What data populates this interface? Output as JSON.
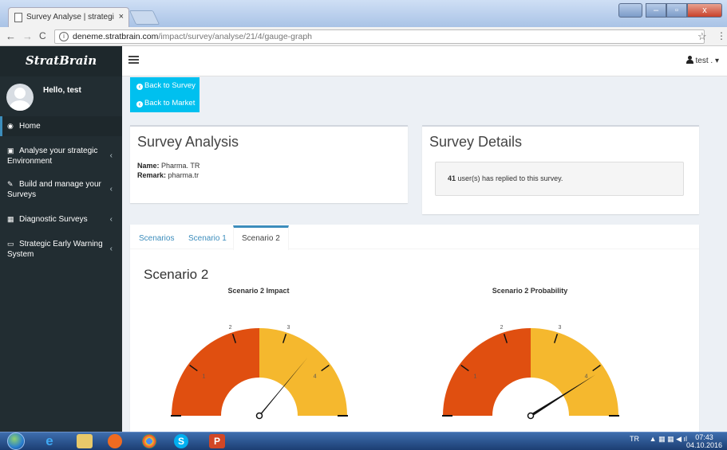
{
  "browser": {
    "tab_title": "Survey Analyse | strategi",
    "tab_close": "×",
    "url_host": "deneme.stratbrain.com",
    "url_path": "/impact/survey/analyse/21/4/gauge-graph",
    "back": "←",
    "forward": "→",
    "reload": "C",
    "info": "i",
    "bookmark": "☆",
    "menu": "⋮"
  },
  "sidebar": {
    "logo": "StratBrain",
    "greeting": "Hello, test",
    "items": [
      {
        "label": "Home",
        "icon": "dashboard-icon",
        "glyph": "◉",
        "chevron": ""
      },
      {
        "label": "Analyse your strategic Environment",
        "icon": "image-icon",
        "glyph": "▣",
        "chevron": "‹"
      },
      {
        "label": "Build and manage your Surveys",
        "icon": "edit-icon",
        "glyph": "✎",
        "chevron": "‹"
      },
      {
        "label": "Diagnostic Surveys",
        "icon": "calendar-icon",
        "glyph": "▦",
        "chevron": "‹"
      },
      {
        "label": "Strategic Early Warning System",
        "icon": "laptop-icon",
        "glyph": "▭",
        "chevron": "‹"
      }
    ]
  },
  "header": {
    "user": "test .",
    "caret": "▾"
  },
  "buttons": {
    "back_to_survey": "Back to Survey",
    "back_to_market": "Back to Market"
  },
  "analysis": {
    "title": "Survey Analysis",
    "name_label": "Name:",
    "name_value": "Pharma. TR",
    "remark_label": "Remark:",
    "remark_value": "pharma.tr"
  },
  "details": {
    "title": "Survey Details",
    "count": "41",
    "text": "user(s) has replied to this survey."
  },
  "tabs": [
    "Scenarios",
    "Scenario 1",
    "Scenario 2"
  ],
  "active_tab": "Scenario 2",
  "scenario_heading": "Scenario 2",
  "colors": {
    "low": "#e04f10",
    "high": "#f5b82e",
    "accent": "#3c8dbc",
    "button": "#00c0ef"
  },
  "gauges": [
    {
      "title": "Scenario 2 Impact",
      "min": 0,
      "max": 5,
      "value": 3.6,
      "band_split": 2.5,
      "ticks": [
        "1",
        "2",
        "3",
        "4"
      ]
    },
    {
      "title": "Scenario 2 Probability",
      "min": 0,
      "max": 5,
      "value": 4.1,
      "band_split": 2.5,
      "ticks": [
        "1",
        "2",
        "3",
        "4"
      ]
    }
  ],
  "taskbar": {
    "lang": "TR",
    "time": "07:43",
    "date": "04.10.2016"
  }
}
